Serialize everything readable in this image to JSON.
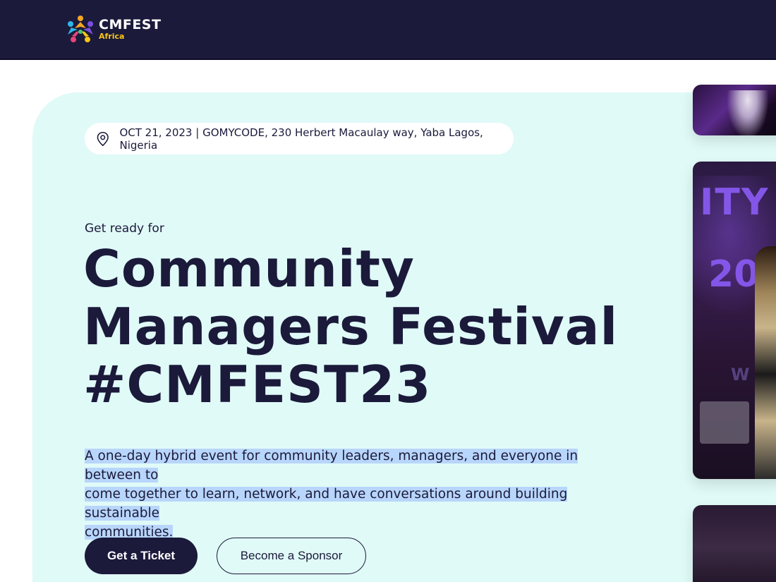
{
  "brand": {
    "name": "CMFEST",
    "subtitle": "Africa"
  },
  "event": {
    "location_line": "OCT 21, 2023 | GOMYCODE, 230 Herbert Macaulay way, Yaba Lagos, Nigeria"
  },
  "hero": {
    "eyebrow": "Get ready for",
    "headline_lines": [
      "Community",
      "Managers Festival",
      "#CMFEST23"
    ],
    "description_lines": [
      "A one-day hybrid event for community leaders, managers, and everyone in between to",
      "come together to learn, network, and have conversations around building sustainable",
      "communities."
    ],
    "primary_button": "Get a Ticket",
    "secondary_button": "Become a Sponsor"
  },
  "icons": {
    "location": "map-pin-icon"
  },
  "colors": {
    "navy": "#1b1a3b",
    "hero_bg": "#e0faf7",
    "highlight": "#b8d6fb",
    "accent_yellow": "#f5c518"
  }
}
